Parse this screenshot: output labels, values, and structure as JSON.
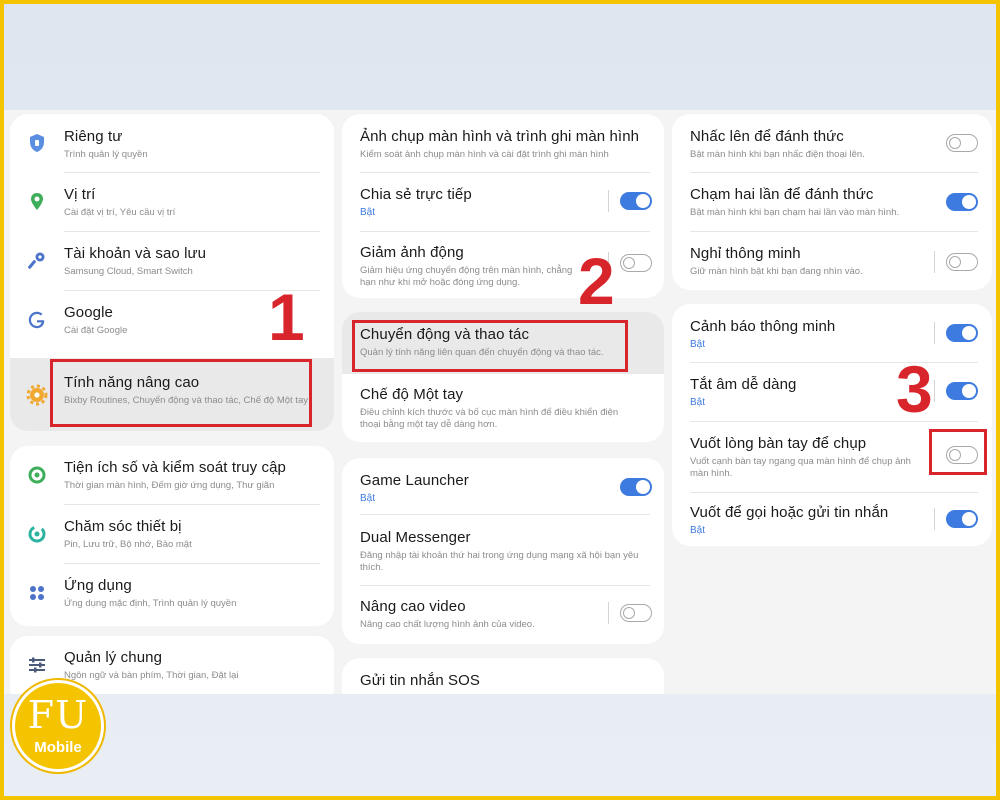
{
  "col1": {
    "items": [
      {
        "title": "Riêng tư",
        "sub": "Trình quản lý quyền"
      },
      {
        "title": "Vị trí",
        "sub": "Cài đặt vị trí, Yêu cầu vị trí"
      },
      {
        "title": "Tài khoản và sao lưu",
        "sub": "Samsung Cloud, Smart Switch"
      },
      {
        "title": "Google",
        "sub": "Cài đặt Google"
      },
      {
        "title": "Tính năng nâng cao",
        "sub": "Bixby Routines, Chuyển động và thao tác, Chế độ Một tay"
      },
      {
        "title": "Tiện ích số và kiểm soát truy cập",
        "sub": "Thời gian màn hình, Đếm giờ ứng dụng, Thư giãn"
      },
      {
        "title": "Chăm sóc thiết bị",
        "sub": "Pin, Lưu trữ, Bộ nhớ, Bảo mật"
      },
      {
        "title": "Ứng dụng",
        "sub": "Ứng dụng mặc định, Trình quản lý quyền"
      },
      {
        "title": "Quản lý chung",
        "sub": "Ngôn ngữ và bàn phím, Thời gian, Đặt lại"
      }
    ]
  },
  "col2": {
    "items": [
      {
        "title": "Ảnh chụp màn hình và trình ghi màn hình",
        "sub": "Kiểm soát ảnh chụp màn hình và cài đặt trình ghi màn hình"
      },
      {
        "title": "Chia sẻ trực tiếp",
        "sub": "Bật"
      },
      {
        "title": "Giảm ảnh động",
        "sub": "Giảm hiệu ứng chuyển động trên màn hình, chẳng hạn như khi mở hoặc đóng ứng dụng."
      },
      {
        "title": "Chuyển động và thao tác",
        "sub": "Quản lý tính năng liên quan đến chuyển động và thao tác."
      },
      {
        "title": "Chế độ Một tay",
        "sub": "Điều chỉnh kích thước và bố cục màn hình để điều khiển điện thoại bằng một tay dễ dàng hơn."
      },
      {
        "title": "Game Launcher",
        "sub": "Bật"
      },
      {
        "title": "Dual Messenger",
        "sub": "Đăng nhập tài khoản thứ hai trong ứng dụng mạng xã hội bạn yêu thích."
      },
      {
        "title": "Nâng cao video",
        "sub": "Nâng cao chất lượng hình ảnh của video."
      },
      {
        "title": "Gửi tin nhắn SOS",
        "sub": ""
      }
    ]
  },
  "col3": {
    "items": [
      {
        "title": "Nhấc lên để đánh thức",
        "sub": "Bật màn hình khi bạn nhấc điện thoại lên."
      },
      {
        "title": "Chạm hai lần để đánh thức",
        "sub": "Bật màn hình khi bạn chạm hai lần vào màn hình."
      },
      {
        "title": "Nghỉ thông minh",
        "sub": "Giữ màn hình bật khi bạn đang nhìn vào."
      },
      {
        "title": "Cảnh báo thông minh",
        "sub": "Bật"
      },
      {
        "title": "Tắt âm dễ dàng",
        "sub": "Bật"
      },
      {
        "title": "Vuốt lòng bàn tay để chụp",
        "sub": "Vuốt cạnh bàn tay ngang qua màn hình để chụp ảnh màn hình."
      },
      {
        "title": "Vuốt để gọi hoặc gửi tin nhắn",
        "sub": "Bật"
      }
    ]
  },
  "toggles": {
    "chia_se_truc_tiep": true,
    "giam_anh_dong": false,
    "game_launcher": true,
    "nang_cao_video": false,
    "nhac_len": false,
    "cham_hai_lan": true,
    "nghi_thong_minh": false,
    "canh_bao_thong_minh": true,
    "tat_am_de_dang": true,
    "vuot_long_ban_tay": false,
    "vuot_de_goi": true
  },
  "steps": {
    "one": "1",
    "two": "2",
    "three": "3"
  },
  "logo": {
    "text_top": "FU",
    "text_bottom": "Mobile"
  },
  "colors": {
    "accent": "#3e7be0",
    "highlight": "#d8242b",
    "brand": "#f5c400"
  },
  "icons": [
    "shield-icon",
    "location-pin-icon",
    "key-icon",
    "google-icon",
    "gear-icon",
    "digital-wellbeing-icon",
    "device-care-icon",
    "apps-grid-icon",
    "sliders-icon"
  ]
}
